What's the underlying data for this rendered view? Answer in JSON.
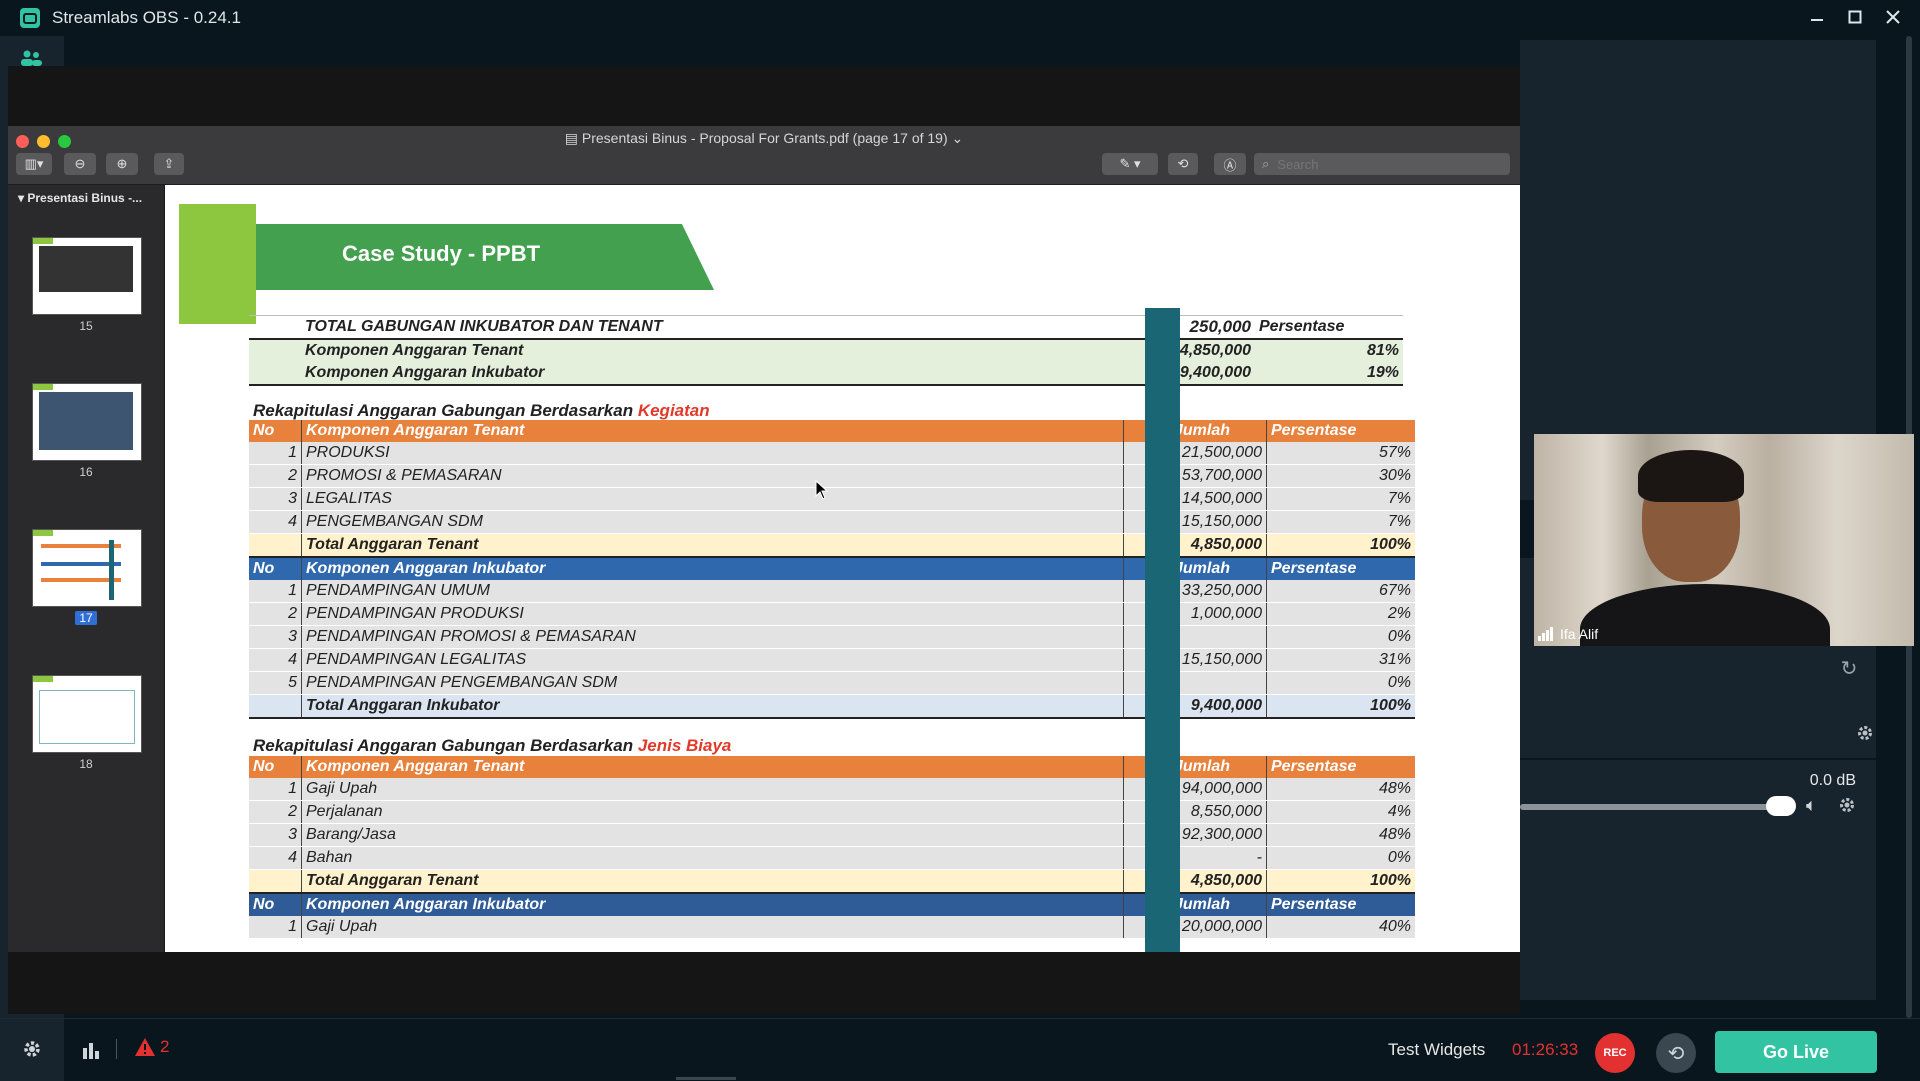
{
  "window": {
    "title": "Streamlabs OBS - 0.24.1"
  },
  "preview": {
    "title": "Presentasi Binus - Proposal For Grants.pdf (page 17 of 19)",
    "search_placeholder": "Search",
    "sidebar_heading": "Presentasi Binus -...",
    "thumbnails": [
      {
        "page": "15",
        "selected": false
      },
      {
        "page": "16",
        "selected": false
      },
      {
        "page": "17",
        "selected": true
      },
      {
        "page": "18",
        "selected": false
      }
    ]
  },
  "slide": {
    "banner": "Case Study - PPBT",
    "summary": {
      "rows": [
        {
          "label": "TOTAL GABUNGAN INKUBATOR DAN TENANT",
          "amount": "250,000",
          "pct": "Persentase"
        },
        {
          "label": "Komponen Anggaran Tenant",
          "amount": "4,850,000",
          "pct": "81%"
        },
        {
          "label": "Komponen Anggaran Inkubator",
          "amount": "9,400,000",
          "pct": "19%"
        }
      ]
    },
    "section1": {
      "title": "Rekapitulasi Anggaran Gabungan Berdasarkan",
      "title_red": "Kegiatan",
      "tenant_header": {
        "no": "No",
        "name": "Komponen Anggaran Tenant",
        "amount": "Jumlah",
        "pct": "Persentase"
      },
      "tenant_rows": [
        {
          "no": "1",
          "name": "PRODUKSI",
          "amount": "21,500,000",
          "pct": "57%"
        },
        {
          "no": "2",
          "name": "PROMOSI & PEMASARAN",
          "amount": "53,700,000",
          "pct": "30%"
        },
        {
          "no": "3",
          "name": "LEGALITAS",
          "amount": "14,500,000",
          "pct": "7%"
        },
        {
          "no": "4",
          "name": "PENGEMBANGAN SDM",
          "amount": "15,150,000",
          "pct": "7%"
        }
      ],
      "tenant_total": {
        "name": "Total Anggaran Tenant",
        "amount": "4,850,000",
        "pct": "100%"
      },
      "inkubator_header": {
        "no": "No",
        "name": "Komponen Anggaran Inkubator",
        "amount": "Jumlah",
        "pct": "Persentase"
      },
      "inkubator_rows": [
        {
          "no": "1",
          "name": "PENDAMPINGAN UMUM",
          "amount": "33,250,000",
          "pct": "67%"
        },
        {
          "no": "2",
          "name": "PENDAMPINGAN PRODUKSI",
          "amount": "1,000,000",
          "pct": "2%"
        },
        {
          "no": "3",
          "name": "PENDAMPINGAN PROMOSI & PEMASARAN",
          "amount": "",
          "pct": "0%"
        },
        {
          "no": "4",
          "name": "PENDAMPINGAN LEGALITAS",
          "amount": "15,150,000",
          "pct": "31%"
        },
        {
          "no": "5",
          "name": "PENDAMPINGAN PENGEMBANGAN SDM",
          "amount": "",
          "pct": "0%"
        }
      ],
      "inkubator_total": {
        "name": "Total Anggaran Inkubator",
        "amount": "9,400,000",
        "pct": "100%"
      }
    },
    "section2": {
      "title": "Rekapitulasi Anggaran Gabungan Berdasarkan",
      "title_red": "Jenis Biaya",
      "tenant_header": {
        "no": "No",
        "name": "Komponen Anggaran Tenant",
        "amount": "Jumlah",
        "pct": "Persentase"
      },
      "tenant_rows": [
        {
          "no": "1",
          "name": "Gaji Upah",
          "amount": "94,000,000",
          "pct": "48%"
        },
        {
          "no": "2",
          "name": "Perjalanan",
          "amount": "8,550,000",
          "pct": "4%"
        },
        {
          "no": "3",
          "name": "Barang/Jasa",
          "amount": "92,300,000",
          "pct": "48%"
        },
        {
          "no": "4",
          "name": "Bahan",
          "amount": "-",
          "pct": "0%"
        }
      ],
      "tenant_total": {
        "name": "Total Anggaran Tenant",
        "amount": "4,850,000",
        "pct": "100%"
      },
      "inkubator_header": {
        "no": "No",
        "name": "Komponen Anggaran Inkubator",
        "amount": "Jumlah",
        "pct": "Persentase"
      },
      "inkubator_rows": [
        {
          "no": "1",
          "name": "Gaji Upah",
          "amount": "20,000,000",
          "pct": "40%"
        }
      ]
    }
  },
  "webcam": {
    "name": "Ifa Alif"
  },
  "mixer": {
    "level": "0.0 dB"
  },
  "footer": {
    "warnings_count": "2",
    "test_widgets": "Test Widgets",
    "timer": "01:26:33",
    "rec_label": "REC",
    "golive_label": "Go Live"
  },
  "colors": {
    "accent": "#31c3a2",
    "rec": "#e33131",
    "timer": "#e33131",
    "warning": "#e33131"
  }
}
